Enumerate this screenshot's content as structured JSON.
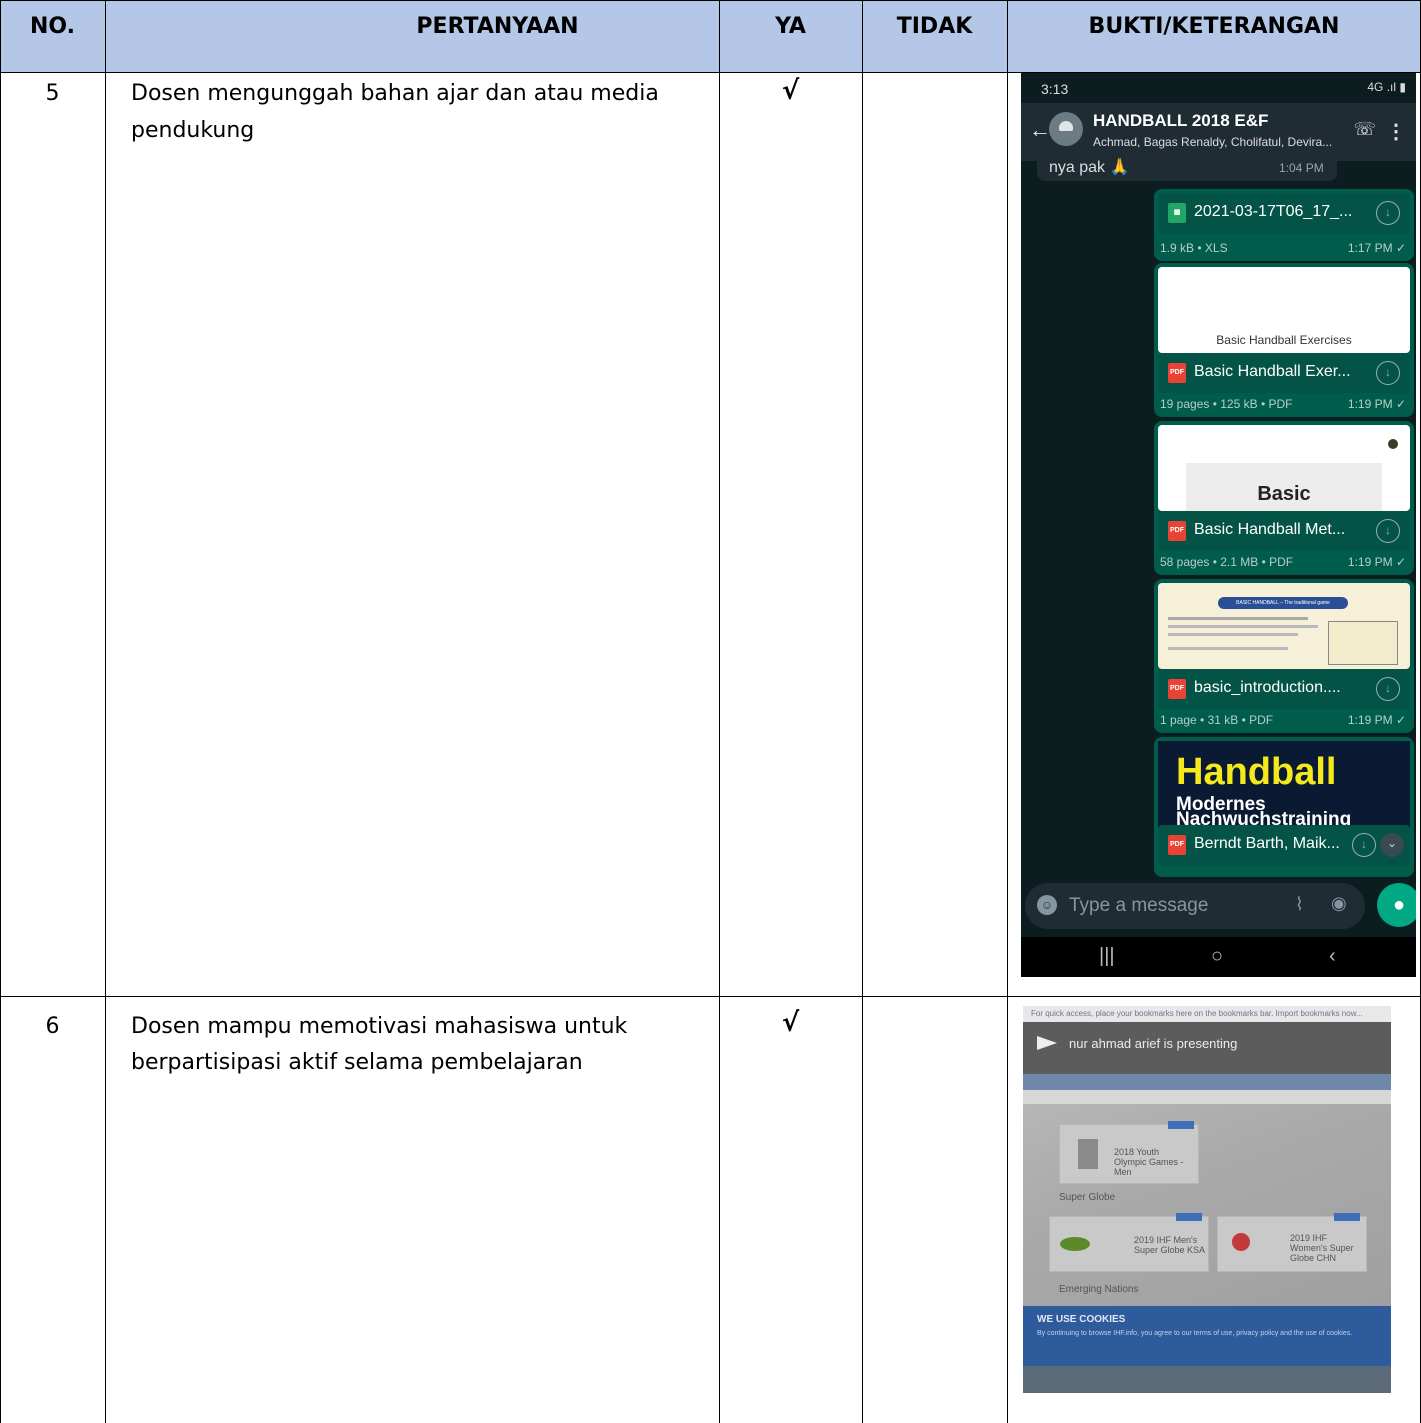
{
  "header": {
    "no": "NO.",
    "pertanyaan": "PERTANYAAN",
    "ya": "YA",
    "tidak": "TIDAK",
    "bukti": "BUKTI/KETERANGAN"
  },
  "rows": [
    {
      "no": "5",
      "question_line1": "Dosen mengunggah bahan ajar dan atau media",
      "question_line2": "pendukung",
      "ya": "√",
      "tidak": ""
    },
    {
      "no": "6",
      "question_line1": "Dosen mampu memotivasi mahasiswa untuk",
      "question_line2": "berpartisipasi aktif selama pembelajaran",
      "ya": "√",
      "tidak": ""
    }
  ],
  "phone": {
    "time": "3:13",
    "status_right": "4G .ıl ▮",
    "chat_title": "HANDBALL 2018 E&F",
    "members": "Achmad, Bagas Renaldy, Cholifatul, Devira...",
    "prev_message": "nya pak 🙏",
    "prev_time": "1:04 PM",
    "messages": [
      {
        "file": "2021-03-17T06_17_...",
        "meta": "1.9 kB • XLS",
        "time": "1:17 PM ✓",
        "icon": "xls"
      },
      {
        "thumb_caption": "Basic Handball Exercises",
        "file": "Basic Handball Exer...",
        "meta": "19 pages • 125 kB • PDF",
        "time": "1:19 PM ✓",
        "icon": "pdf"
      },
      {
        "thumb_big": "Basic",
        "file": "Basic Handball Met...",
        "meta": "58 pages • 2.1 MB • PDF",
        "time": "1:19 PM ✓",
        "icon": "pdf"
      },
      {
        "thumb_banner": "BASIC HANDBALL – The traditional game",
        "file": "basic_introduction....",
        "meta": "1 page • 31 kB • PDF",
        "time": "1:19 PM ✓",
        "icon": "pdf"
      },
      {
        "cover_title": "Handball",
        "cover_sub1": "Modernes",
        "cover_sub2": "Nachwuchstraining",
        "file": "Berndt Barth, Maik...",
        "icon": "pdf"
      }
    ],
    "input_placeholder": "Type a message",
    "icons": {
      "back": "back-arrow-icon",
      "call": "add-call-icon",
      "menu": "more-vert-icon",
      "download": "download-icon",
      "emoji": "emoji-icon",
      "attach": "paperclip-icon",
      "camera": "camera-icon",
      "mic": "mic-icon"
    }
  },
  "photo": {
    "bookmark_bar": "For quick access, place your bookmarks here on the bookmarks bar. Import bookmarks now...",
    "presenting": "nur ahmad arief is presenting",
    "card1_text": "2018 Youth Olympic Games - Men",
    "section": "Super Globe",
    "card2_text": "2019 IHF Men's Super Globe KSA",
    "card3_text": "2019 IHF Women's Super Globe CHN",
    "section2": "Emerging Nations",
    "cookie_title": "WE USE COOKIES",
    "cookie_text": "By continuing to browse IHF.info, you agree to our terms of use, privacy policy and the use of cookies."
  }
}
